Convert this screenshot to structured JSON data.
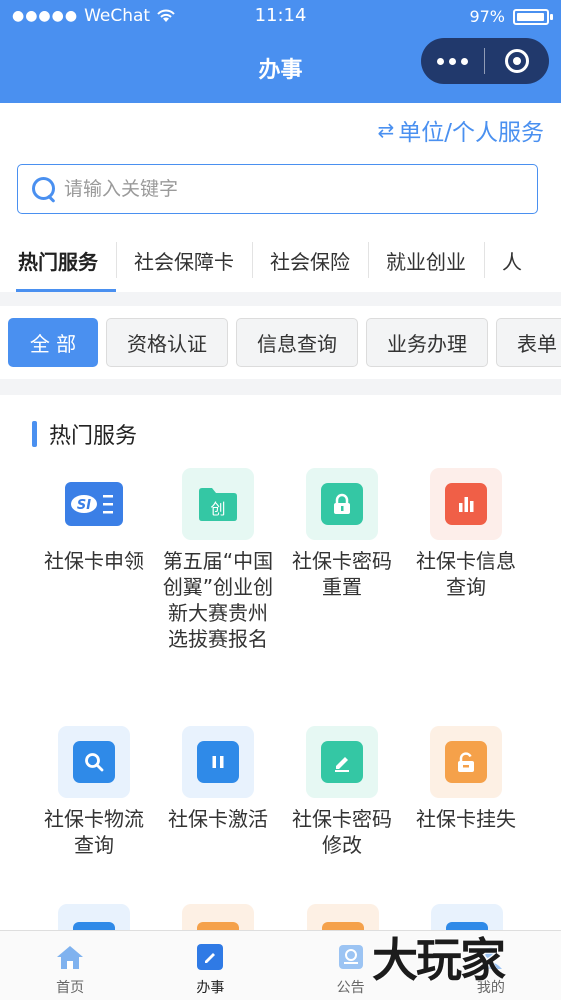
{
  "status_bar": {
    "carrier": "WeChat",
    "time": "11:14",
    "battery": "97%",
    "battery_level": 0.97
  },
  "nav": {
    "title": "办事"
  },
  "switch_link": {
    "icon": "swap-icon",
    "label": "单位/个人服务"
  },
  "search": {
    "placeholder": "请输入关键字",
    "value": ""
  },
  "tabs": [
    {
      "label": "热门服务",
      "active": true
    },
    {
      "label": "社会保障卡",
      "active": false
    },
    {
      "label": "社会保险",
      "active": false
    },
    {
      "label": "就业创业",
      "active": false
    },
    {
      "label": "人",
      "active": false
    }
  ],
  "chips": [
    {
      "label": "全 部",
      "active": true
    },
    {
      "label": "资格认证",
      "active": false
    },
    {
      "label": "信息查询",
      "active": false
    },
    {
      "label": "业务办理",
      "active": false
    },
    {
      "label": "表单",
      "active": false
    }
  ],
  "section": {
    "title": "热门服务"
  },
  "services": [
    {
      "label": "社保卡申领",
      "icon": "social-security-card-icon",
      "bg": "#ffffff",
      "fg": "#3b7fe6"
    },
    {
      "label": "第五届“中国创翼”创业创新大赛贵州选拔赛报名",
      "icon": "folder-icon",
      "bg": "#e6f8f3",
      "fg": "#34c7a4"
    },
    {
      "label": "社保卡密码重置",
      "icon": "lock-icon",
      "bg": "#e6f8f3",
      "fg": "#34c7a4"
    },
    {
      "label": "社保卡信息查询",
      "icon": "bar-chart-icon",
      "bg": "#fdeeea",
      "fg": "#f05f47"
    },
    {
      "label": "社保卡物流查询",
      "icon": "search-icon",
      "bg": "#e8f2fd",
      "fg": "#2f8ae8"
    },
    {
      "label": "社保卡激活",
      "icon": "pause-icon",
      "bg": "#e8f2fd",
      "fg": "#2f8ae8"
    },
    {
      "label": "社保卡密码修改",
      "icon": "edit-icon",
      "bg": "#e6f8f3",
      "fg": "#34c7a4"
    },
    {
      "label": "社保卡挂失",
      "icon": "unlock-icon",
      "bg": "#fdf0e4",
      "fg": "#f5a14a"
    }
  ],
  "tabbar": [
    {
      "label": "首页",
      "icon": "home-icon",
      "active": false
    },
    {
      "label": "办事",
      "icon": "edit-icon",
      "active": true
    },
    {
      "label": "公告",
      "icon": "notice-icon",
      "active": false
    },
    {
      "label": "我的",
      "icon": "user-icon",
      "active": false
    }
  ],
  "watermark": {
    "text": "大玩家"
  },
  "colors": {
    "accent": "#4a90f0",
    "capsule": "#21396c"
  }
}
